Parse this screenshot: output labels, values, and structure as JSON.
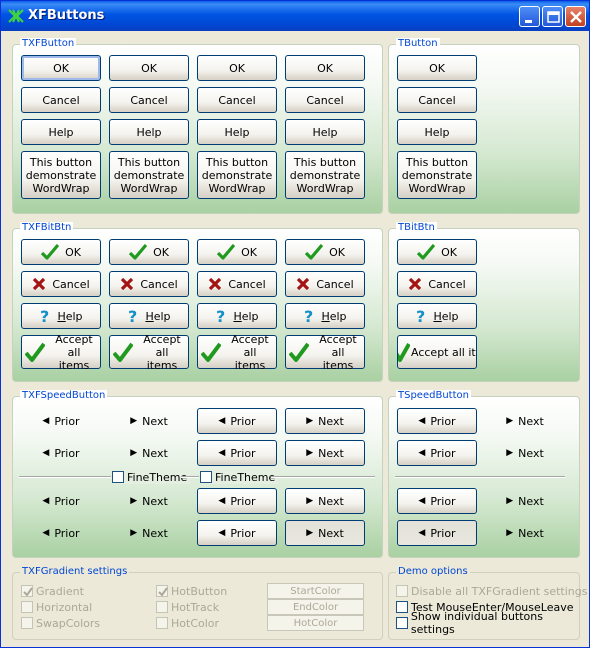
{
  "window": {
    "title": "XFButtons",
    "minimize_icon": "minimize-icon",
    "maximize_icon": "maximize-icon",
    "close_icon": "close-icon"
  },
  "txfbutton": {
    "legend": "TXFButton",
    "ok": "OK",
    "cancel": "Cancel",
    "help": "Help",
    "wrap": "This button demonstrate WordWrap"
  },
  "tbutton": {
    "legend": "TButton",
    "ok": "OK",
    "cancel": "Cancel",
    "help": "Help",
    "wrap": "This button demonstrate WordWrap"
  },
  "txfbitbtn": {
    "legend": "TXFBitBtn",
    "ok": "OK",
    "cancel": "Cancel",
    "help_h": "H",
    "help_rest": "elp",
    "accept": "Accept all items"
  },
  "tbitbtn": {
    "legend": "TBitBtn",
    "ok": "OK",
    "cancel": "Cancel",
    "help_h": "H",
    "help_rest": "elp",
    "accept": "Accept all iten"
  },
  "txfspeed": {
    "legend": "TXFSpeedButton",
    "prior": "Prior",
    "next": "Next",
    "fine_theme_1": "FineTheme",
    "fine_theme_2": "FineTheme"
  },
  "tspeed": {
    "legend": "TSpeedButton",
    "prior": "Prior",
    "next": "Next"
  },
  "gradient_settings": {
    "legend": "TXFGradient settings",
    "gradient": "Gradient",
    "horizontal": "Horizontal",
    "swapcolors": "SwapColors",
    "hotbutton": "HotButton",
    "hottrack": "HotTrack",
    "hotcolor_cb": "HotColor",
    "startcolor": "StartColor",
    "endcolor": "EndColor",
    "hotcolor_btn": "HotColor"
  },
  "demo_options": {
    "legend": "Demo options",
    "disable_all": "Disable all TXFGradient settings",
    "test_mouse": "Test MouseEnter/MouseLeave",
    "show_individual": "Show individual buttons settings"
  },
  "colors": {
    "titlebar": "#0054e3",
    "legend_text": "#0046d5",
    "gradient_bottom": "#a9d0a2",
    "check_green": "#1f9a1f",
    "cross_red": "#a31515",
    "help_cyan": "#1590c8"
  },
  "icons": {
    "ok": "check-icon",
    "cancel": "cross-icon",
    "help": "question-icon",
    "prior": "triangle-left-icon",
    "next": "triangle-right-icon"
  }
}
